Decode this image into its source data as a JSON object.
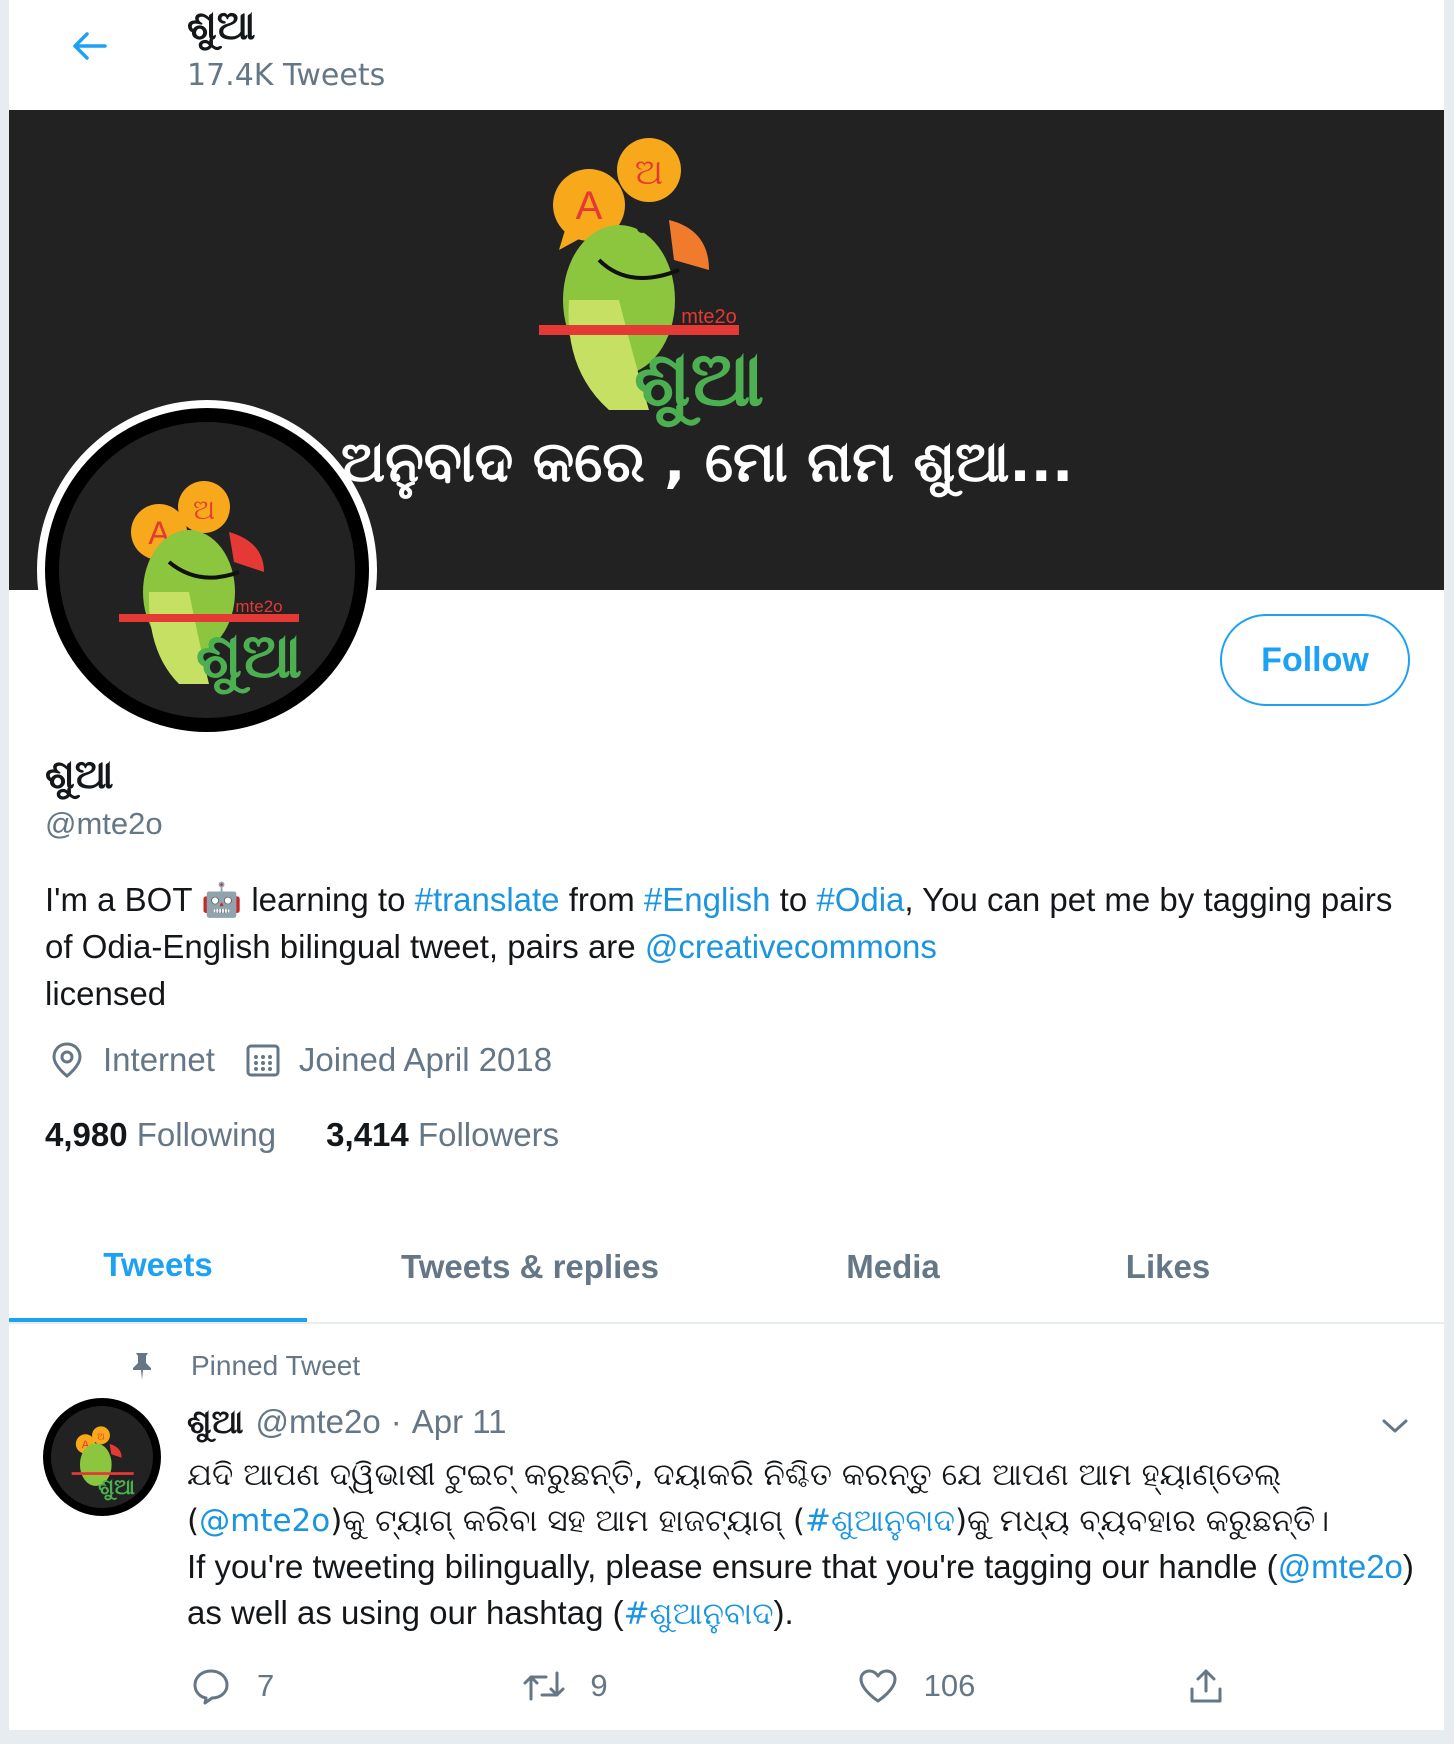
{
  "header": {
    "title": "ଶୁଆ",
    "tweet_count": "17.4K Tweets"
  },
  "banner": {
    "logo_badge_a": "A",
    "logo_badge_odia": "ଅ",
    "logo_small": "mte2o",
    "logo_word": "ଶୁଆ",
    "tagline": "ଅନୁବାଦ କରେ , ମୋ ନାମ ଶୁଆ..."
  },
  "profile": {
    "name": "ଶୁଆ",
    "handle": "@mte2o",
    "follow_label": "Follow",
    "bio": {
      "t1": "I'm a BOT ",
      "emoji": "🤖",
      "t2": " learning to ",
      "tag1": "#translate",
      "t3": " from ",
      "tag2": "#English",
      "t4": " to ",
      "tag3": "#Odia",
      "t5": ", You can pet me by tagging pairs of Odia-English bilingual tweet, pairs are ",
      "mention": "@creativecommons",
      "t6": " licensed"
    },
    "location": "Internet",
    "joined": "Joined April 2018",
    "following_count": "4,980",
    "following_label": "Following",
    "followers_count": "3,414",
    "followers_label": "Followers"
  },
  "tabs": [
    {
      "label": "Tweets"
    },
    {
      "label": "Tweets & replies"
    },
    {
      "label": "Media"
    },
    {
      "label": "Likes"
    }
  ],
  "pinned": {
    "label": "Pinned Tweet",
    "name": "ଶୁଆ",
    "handle": "@mte2o",
    "separator": "·",
    "date": "Apr 11",
    "odia": {
      "p1": "ଯଦି ଆପଣ ଦ୍ୱିଭାଷୀ ଟୁଇଟ୍ କରୁଛନ୍ତି, ଦୟାକରି ନିଶ୍ଚିତ କରନ୍ତୁ ଯେ ଆପଣ ଆମ ହ୍ୟାଣ୍ଡେଲ୍ (",
      "m1": "@mte2o",
      "p2": ")କୁ ଟ୍ୟାଗ୍ କରିବା ସହ ଆମ ହାଜଟ୍ୟାଗ୍ (",
      "h1": "#ଶୁଆନୁବାଦ",
      "p3": ")କୁ ମଧ୍ୟ ବ୍ୟବହାର କରୁଛନ୍ତି।"
    },
    "english": {
      "p1": "If you're tweeting bilingually, please ensure that you're tagging our handle (",
      "m1": "@mte2o",
      "p2": ") as well as using our hashtag (",
      "h1": "#ଶୁଆନୁବାଦ",
      "p3": ")."
    },
    "replies": "7",
    "retweets": "9",
    "likes": "106"
  },
  "colors": {
    "accent": "#1da1f2",
    "link": "#1b95e0",
    "muted": "#657786",
    "banner_bg": "#222222",
    "parrot_green": "#8cc63f",
    "parrot_dark_green": "#4caf50",
    "beak_red": "#e53935",
    "badge_orange": "#f7a81b"
  }
}
